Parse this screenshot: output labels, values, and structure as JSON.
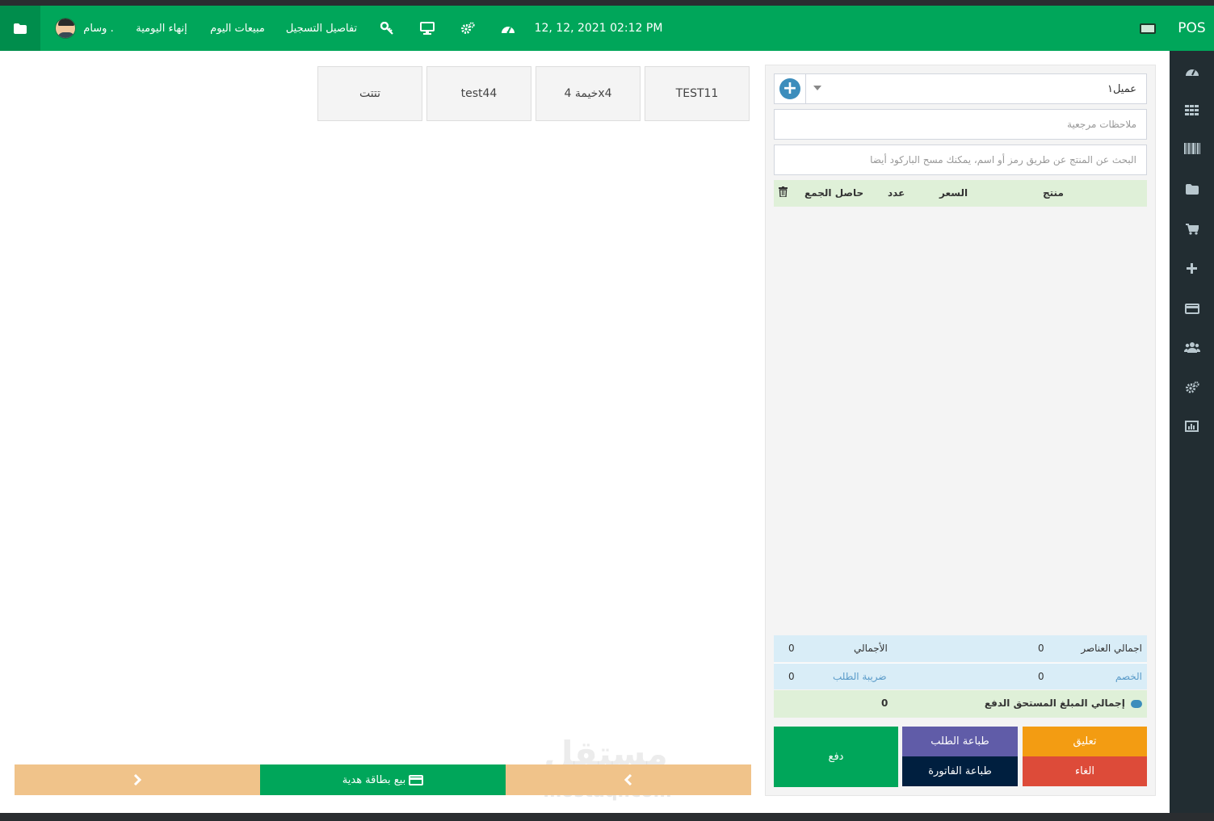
{
  "app": {
    "brand": "POS"
  },
  "header": {
    "user_name": "وسام .",
    "end_of_day": "إنهاء اليومية",
    "today_sales": "مبيعات اليوم",
    "register_details": "تفاصيل التسجيل",
    "datetime": "12, 12, 2021 02:12 PM",
    "icons": [
      "folder-icon",
      "key-icon",
      "desktop-icon",
      "cogs-icon",
      "dashboard-icon",
      "keyboard-icon"
    ]
  },
  "sidebar": {
    "icons": [
      "dashboard-icon",
      "grid-icon",
      "barcode-icon",
      "folder-icon",
      "cart-icon",
      "plus-icon",
      "credit-card-icon",
      "users-icon",
      "cogs-icon",
      "chart-icon"
    ]
  },
  "products": [
    {
      "name": "TEST11"
    },
    {
      "name": "خيمة 4x4"
    },
    {
      "name": "test44"
    },
    {
      "name": "تتتت"
    }
  ],
  "footer_nav": {
    "gift_card": "بيع بطاقة هدية"
  },
  "register": {
    "customer": "عميل١",
    "notes_placeholder": "ملاحظات مرجعية",
    "search_placeholder": "البحث عن المنتج عن طريق رمز أو اسم، يمكنك مسح الباركود أيضا",
    "columns": {
      "product": "منتج",
      "price": "السعر",
      "qty": "عدد",
      "subtotal": "حاصل الجمع"
    },
    "totals": {
      "items_label": "اجمالي العناصر",
      "items_value": "0",
      "total_label": "الأجمالي",
      "total_value": "0",
      "discount_label": "الخصم",
      "discount_value": "0",
      "tax_label": "ضريبة الطلب",
      "tax_value": "0",
      "due_label": "إجمالي المبلغ المستحق الدفع",
      "due_value": "0"
    },
    "actions": {
      "pay": "دفع",
      "print_order": "طباعة الطلب",
      "print_invoice": "طباعة الفاتورة",
      "suspend": "تعليق",
      "cancel": "الغاء"
    }
  },
  "colors": {
    "primary": "#00a65a",
    "sidebar": "#222d32",
    "warning": "#f39c12",
    "danger": "#dd4b39",
    "purple": "#605ca8",
    "navy": "#001f3f"
  }
}
